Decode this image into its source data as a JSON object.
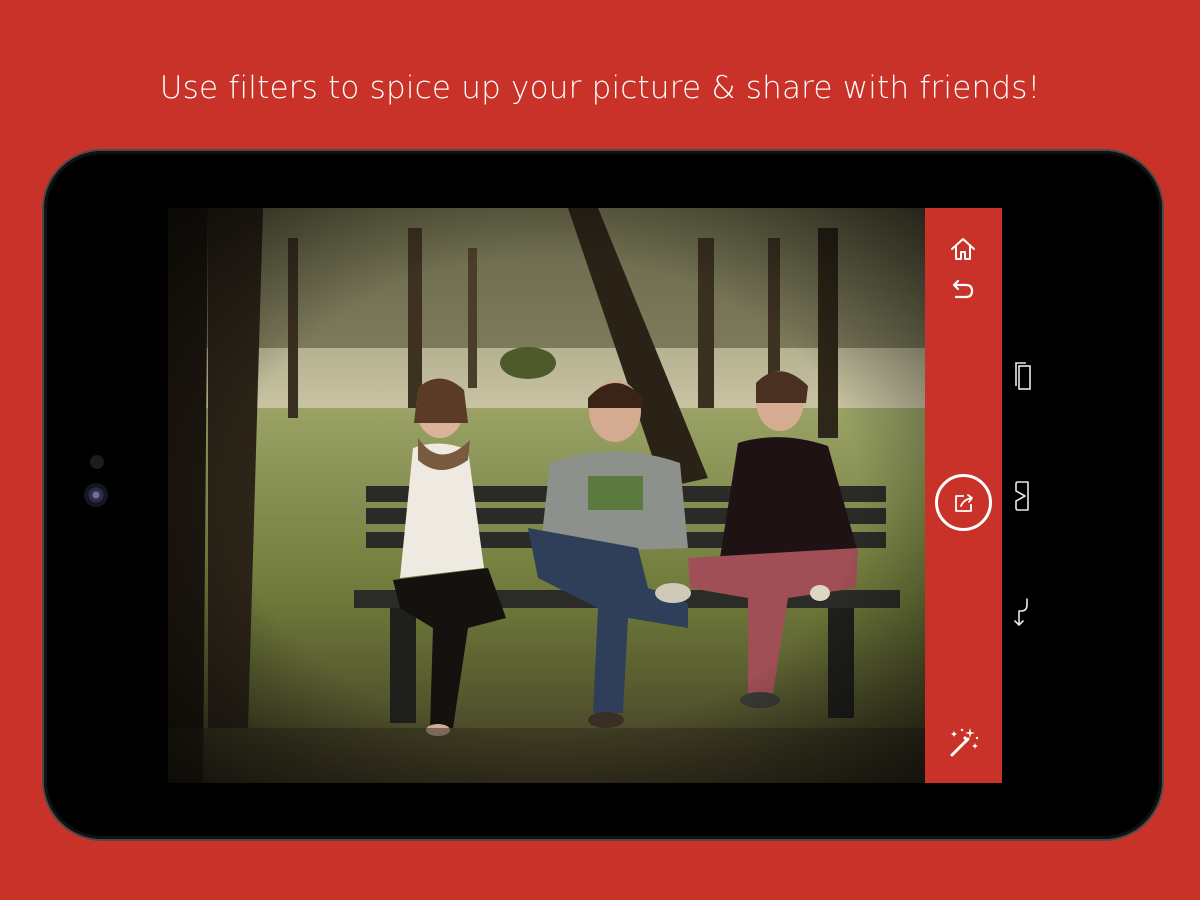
{
  "headline": "Use filters to spice up your picture & share with friends!",
  "colors": {
    "brand_red": "#c93228",
    "device_body": "#000000",
    "icon_color": "#ffffff"
  },
  "side_panel": {
    "buttons": [
      {
        "id": "home",
        "icon": "home-icon"
      },
      {
        "id": "undo",
        "icon": "undo-icon"
      },
      {
        "id": "share",
        "icon": "share-icon"
      },
      {
        "id": "filters",
        "icon": "magic-wand-icon"
      }
    ]
  },
  "system_nav": {
    "keys": [
      {
        "id": "recent",
        "icon": "recent-apps-icon"
      },
      {
        "id": "home",
        "icon": "home-key-icon"
      },
      {
        "id": "back",
        "icon": "back-key-icon"
      }
    ]
  }
}
